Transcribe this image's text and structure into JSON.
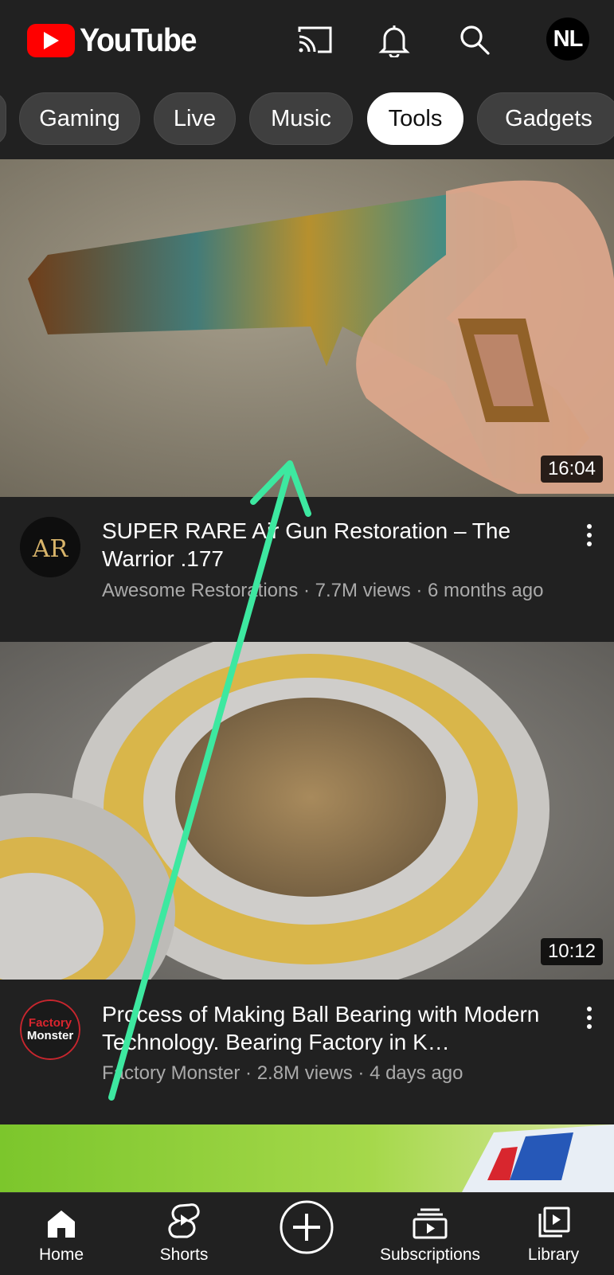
{
  "app": {
    "logo_text": "YouTube",
    "accent_color": "#ff0000"
  },
  "header": {
    "cast_icon": "cast-icon",
    "notifications_icon": "bell-icon",
    "search_icon": "search-icon",
    "avatar_initials": "NL"
  },
  "chips": [
    "Gaming",
    "Live",
    "Music",
    "Tools",
    "Gadgets"
  ],
  "selected_chip": "Tools",
  "videos": [
    {
      "title": "SUPER RARE Air Gun Restoration – The Warrior .177",
      "channel": "Awesome Restorations",
      "views": "7.7M views",
      "age": "6 months ago",
      "subtitle": "Awesome Restorations · 7.7M views · 6 months ago",
      "duration": "16:04",
      "channel_avatar_text": "AR"
    },
    {
      "title": "Process of Making Ball Bearing with Modern Technology. Bearing Factory in K…",
      "channel": "Factory Monster",
      "views": "2.8M views",
      "age": "4 days ago",
      "subtitle": "Factory Monster · 2.8M views · 4 days ago",
      "duration": "10:12",
      "channel_avatar_text_1": "Factory",
      "channel_avatar_text_2": "Monster"
    }
  ],
  "bottom_nav": {
    "home": "Home",
    "shorts": "Shorts",
    "create_icon": "plus-circle-icon",
    "subscriptions": "Subscriptions",
    "library": "Library"
  },
  "gesture_overlay_color": "#3de8a0"
}
